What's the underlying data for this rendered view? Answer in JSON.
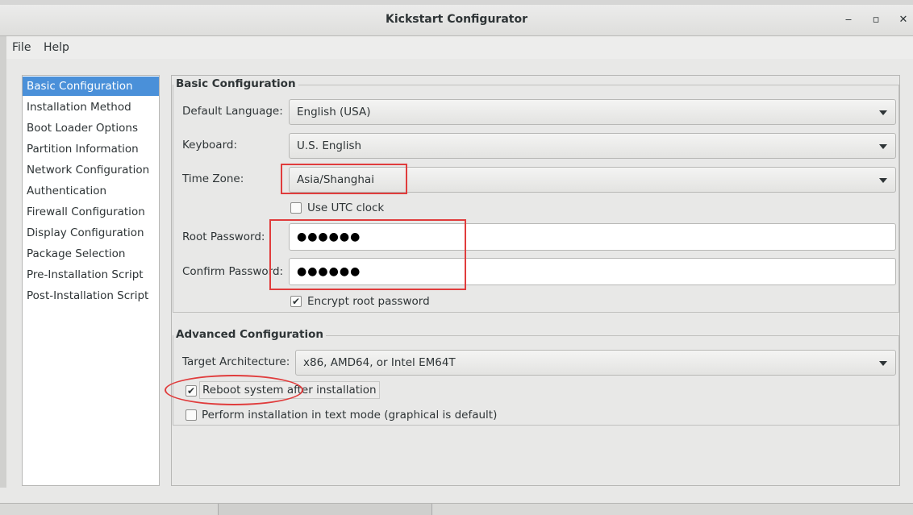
{
  "window": {
    "title": "Kickstart Configurator",
    "minimize_glyph": "‒",
    "maximize_glyph": "▫",
    "close_glyph": "✕"
  },
  "menu": [
    "File",
    "Help"
  ],
  "sidebar": {
    "items": [
      {
        "label": "Basic Configuration",
        "selected": true
      },
      {
        "label": "Installation Method"
      },
      {
        "label": "Boot Loader Options"
      },
      {
        "label": "Partition Information"
      },
      {
        "label": "Network Configuration"
      },
      {
        "label": "Authentication"
      },
      {
        "label": "Firewall Configuration"
      },
      {
        "label": "Display Configuration"
      },
      {
        "label": "Package Selection"
      },
      {
        "label": "Pre-Installation Script"
      },
      {
        "label": "Post-Installation Script"
      }
    ]
  },
  "basic": {
    "section_title": "Basic Configuration",
    "default_language_label": "Default Language:",
    "default_language_value": "English (USA)",
    "keyboard_label": "Keyboard:",
    "keyboard_value": "U.S. English",
    "time_zone_label": "Time Zone:",
    "time_zone_value": "Asia/Shanghai",
    "utc_clock_label": "Use UTC clock",
    "utc_clock_checked": false,
    "root_password_label": "Root Password:",
    "root_password_value": "●●●●●●",
    "confirm_password_label": "Confirm Password:",
    "confirm_password_value": "●●●●●●",
    "encrypt_label": "Encrypt root password",
    "encrypt_checked": true
  },
  "advanced": {
    "section_title": "Advanced Configuration",
    "target_arch_label": "Target Architecture:",
    "target_arch_value": "x86, AMD64, or Intel EM64T",
    "reboot_label": "Reboot system after installation",
    "reboot_checked": true,
    "text_mode_label": "Perform installation in text mode (graphical is default)",
    "text_mode_checked": false
  },
  "check_glyph": "✔",
  "colors": {
    "selection": "#4a90d9",
    "annotation": "#e03c3c"
  }
}
